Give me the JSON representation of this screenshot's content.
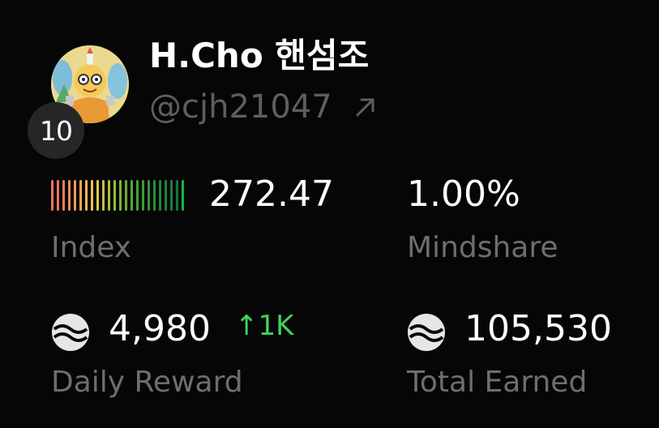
{
  "profile": {
    "display_name": "H.Cho 핸섬조",
    "handle": "@cjh21047",
    "rank": "10"
  },
  "index": {
    "value": "272.47",
    "label": "Index",
    "level_fraction": 1.0,
    "bar_colors": [
      "#e8735e",
      "#e8735e",
      "#ea7d5e",
      "#ec8a5c",
      "#ee9858",
      "#f0a553",
      "#f2b44f",
      "#eec34a",
      "#d9c645",
      "#c4c440",
      "#adc03d",
      "#94ba3b",
      "#7db43a",
      "#68ad3a",
      "#56a63a",
      "#46a03a",
      "#3a9a3a",
      "#2f943a",
      "#288e3a",
      "#22883a",
      "#1f823a",
      "#1c7c3a",
      "#197638",
      "#17b548"
    ]
  },
  "mindshare": {
    "value": "1.00%",
    "label": "Mindshare"
  },
  "daily_reward": {
    "value": "4,980",
    "delta": "↑1K",
    "label": "Daily Reward",
    "icon": "token-icon"
  },
  "total_earned": {
    "value": "105,530",
    "label": "Total Earned",
    "icon": "token-icon"
  }
}
